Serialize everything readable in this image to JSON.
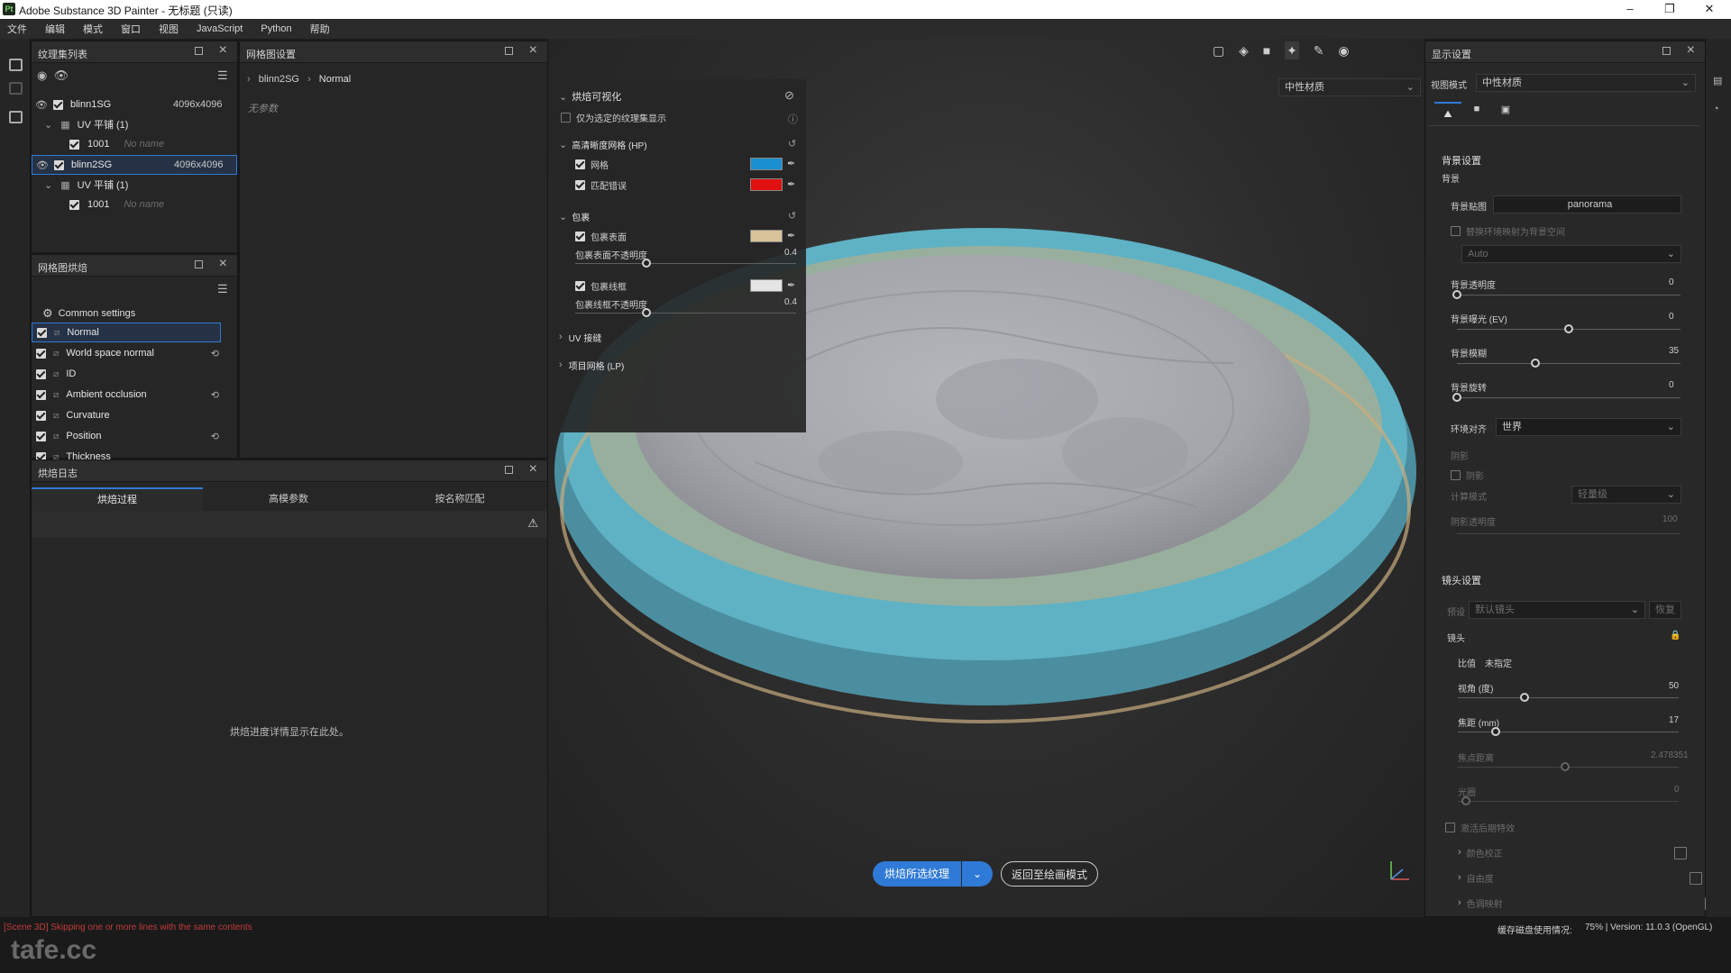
{
  "window": {
    "title": "Adobe Substance 3D Painter - 无标题 (只读)",
    "logo": "Pt"
  },
  "menu": [
    "文件",
    "编辑",
    "模式",
    "窗口",
    "视图",
    "JavaScript",
    "Python",
    "帮助"
  ],
  "texture_set_panel": {
    "title": "纹理集列表",
    "sets": [
      {
        "name": "blinn1SG",
        "size": "4096x4096",
        "uv_label": "UV 平铺 (1)",
        "tile": "1001",
        "tile_name": "No name"
      },
      {
        "name": "blinn2SG",
        "size": "4096x4096",
        "uv_label": "UV 平铺 (1)",
        "tile": "1001",
        "tile_name": "No name"
      }
    ]
  },
  "mesh_settings_panel": {
    "title": "网格图设置",
    "breadcrumb": [
      "blinn2SG",
      "Normal"
    ],
    "empty": "无参数"
  },
  "bake_maps_panel": {
    "title": "网格图烘焙",
    "common": "Common settings",
    "maps": [
      "Normal",
      "World space normal",
      "ID",
      "Ambient occlusion",
      "Curvature",
      "Position",
      "Thickness"
    ]
  },
  "bake_log_panel": {
    "title": "烘焙日志",
    "tabs": [
      "烘焙过程",
      "高模参数",
      "按名称匹配"
    ],
    "message": "烘焙进度详情显示在此处。"
  },
  "bake_visual": {
    "title": "烘焙可视化",
    "only_selected": "仅为选定的纹理集显示",
    "hp_title": "高清晰度网格 (HP)",
    "hp_mesh": "网格",
    "hp_mismatch": "匹配错误",
    "hp_mesh_color": "#1a8fd1",
    "hp_mismatch_color": "#e01010",
    "cage_title": "包裹",
    "cage_surface": "包裹表面",
    "cage_surface_color": "#d8c39a",
    "cage_surface_opacity_label": "包裹表面不透明度",
    "cage_surface_opacity": "0.4",
    "cage_wire": "包裹线框",
    "cage_wire_color": "#e4e4e4",
    "cage_wire_opacity_label": "包裹线框不透明度",
    "cage_wire_opacity": "0.4",
    "uv_title": "UV 接缝",
    "lp_title": "项目网格 (LP)"
  },
  "viewport": {
    "material_dropdown": "中性材质",
    "bake_button": "烘焙所选纹理",
    "return_button": "返回至绘画模式",
    "accent": "#2f7ad6"
  },
  "display_settings": {
    "title": "显示设置",
    "view_mode_label": "视图模式",
    "view_mode": "中性材质",
    "bg_section": "背景设置",
    "bg_label": "背景",
    "bg_map_label": "背景贴图",
    "bg_map": "panorama",
    "use_env": "替换环境映射为背景空间",
    "auto": "Auto",
    "bg_opacity_label": "背景透明度",
    "bg_opacity": "0",
    "bg_opacity_level": 0,
    "bg_exposure_label": "背景曝光 (EV)",
    "bg_exposure": "0",
    "bg_exposure_level": 0.5,
    "bg_blur_label": "背景模糊",
    "bg_blur": "35",
    "bg_blur_level": 0.35,
    "bg_rotation_label": "背景旋转",
    "bg_rotation": "0",
    "bg_rotation_level": 0,
    "env_align_label": "环境对齐",
    "env_align": "世界",
    "shadow_section": "阴影",
    "shadow": "阴影",
    "calc_mode_label": "计算模式",
    "calc_mode": "轻量级",
    "shadow_opacity_label": "阴影透明度",
    "shadow_opacity": "100",
    "camera_section": "镜头设置",
    "preset_label": "预设",
    "preset": "默认镜头",
    "restore": "恢复",
    "lens": "镜头",
    "ratio_label": "比值",
    "ratio": "未指定",
    "fov_label": "视角 (度)",
    "fov": "50",
    "fov_level": 0.3,
    "focal_label": "焦距 (mm)",
    "focal": "17",
    "focal_level": 0.17,
    "focus_dist_label": "焦点距离",
    "focus_dist": "2.478351",
    "aperture_label": "光圈",
    "aperture": "0",
    "post_fx": "激活后期特效",
    "color_correction": "颜色校正",
    "dof": "自由度",
    "tone_map": "色调映射"
  },
  "status": {
    "log": "[Scene 3D] Skipping one or more lines with the same contents",
    "cache": "缓存磁盘使用情况:",
    "version": "75% | Version: 11.0.3 (OpenGL)",
    "watermark": "tafe.cc"
  }
}
